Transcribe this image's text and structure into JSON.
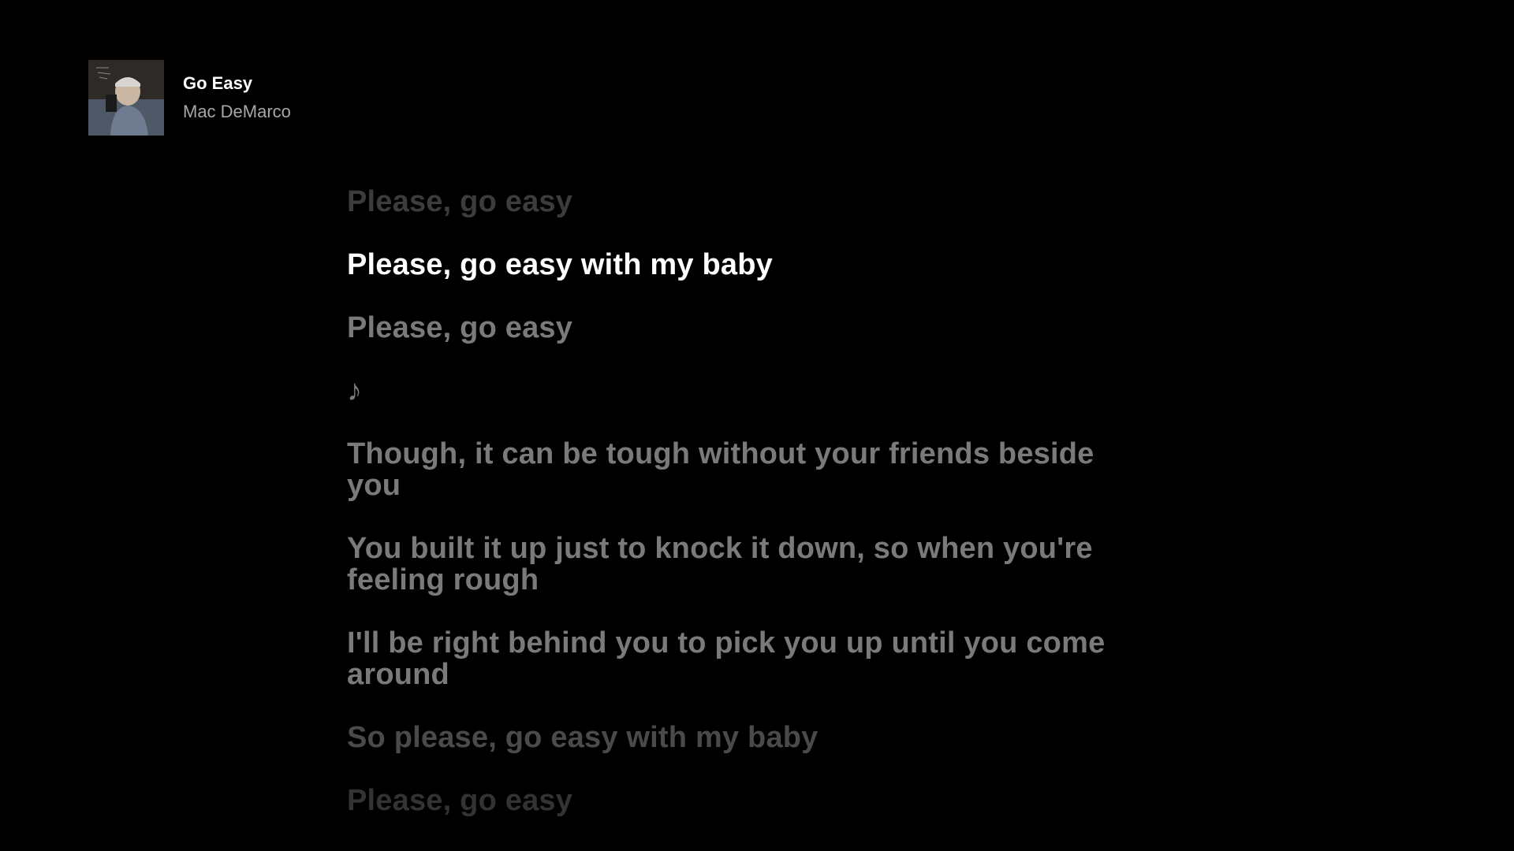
{
  "now_playing": {
    "title": "Go Easy",
    "artist": "Mac DeMarco",
    "album_art_icon": "album-cover"
  },
  "lyrics": {
    "lines": [
      {
        "text": "Please, go easy",
        "state": "past"
      },
      {
        "text": "Please, go easy with my baby",
        "state": "active"
      },
      {
        "text": "Please, go easy",
        "state": "future"
      },
      {
        "text": "♪",
        "state": "future"
      },
      {
        "text": "Though, it can be tough without your friends beside you",
        "state": "future"
      },
      {
        "text": "You built it up just to knock it down, so when you're feeling rough",
        "state": "future"
      },
      {
        "text": "I'll be right behind you to pick you up until you come around",
        "state": "future"
      },
      {
        "text": "So please, go easy with my baby",
        "state": "far"
      },
      {
        "text": "Please, go easy",
        "state": "fade"
      }
    ]
  },
  "colors": {
    "background": "#000000",
    "active_line": "#ffffff",
    "upcoming_line": "#7a7a7a",
    "past_line": "#3c3c3c",
    "artist_text": "#a7a7a7"
  }
}
